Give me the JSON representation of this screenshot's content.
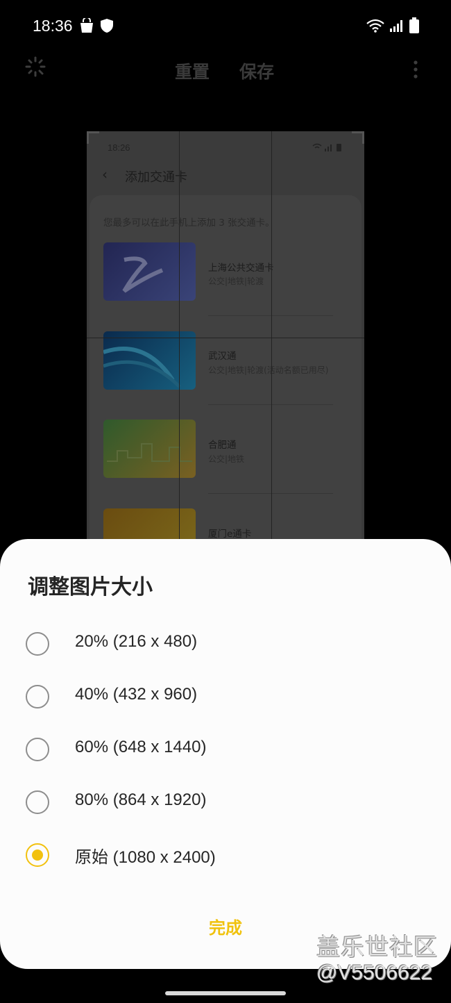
{
  "status_bar": {
    "time": "18:36",
    "icons": [
      "shopping-bag-icon",
      "shield-icon",
      "wifi-icon",
      "signal-icon",
      "battery-icon"
    ]
  },
  "toolbar": {
    "reset_label": "重置",
    "save_label": "保存",
    "icons": [
      "resize-icon",
      "more-options-icon"
    ]
  },
  "preview": {
    "time": "18:26",
    "title": "添加交通卡",
    "description": "您最多可以在此手机上添加 3 张交通卡。",
    "cards": [
      {
        "name": "上海公共交通卡",
        "subtitle": "公交|地铁|轮渡",
        "color_a": "#2a2c5a",
        "color_b": "#4a5aa0"
      },
      {
        "name": "武汉通",
        "subtitle": "公交|地铁|轮渡(活动名额已用尽)",
        "color_a": "#0d2f52",
        "color_b": "#1d6a8e"
      },
      {
        "name": "合肥通",
        "subtitle": "公交|地铁",
        "color_a": "#3b5a2a",
        "color_b": "#7a6a2a"
      },
      {
        "name": "厦门e通卡",
        "subtitle": "",
        "color_a": "#6a5214",
        "color_b": "#7a6a20"
      }
    ]
  },
  "sheet": {
    "title": "调整图片大小",
    "options": [
      {
        "label": "20% (216 x 480)",
        "checked": false
      },
      {
        "label": "40% (432 x 960)",
        "checked": false
      },
      {
        "label": "60% (648 x 1440)",
        "checked": false
      },
      {
        "label": "80% (864 x 1920)",
        "checked": false
      },
      {
        "label": "原始 (1080 x 2400)",
        "checked": true
      }
    ],
    "done_label": "完成"
  },
  "watermark": {
    "line1": "盖乐世社区",
    "line2": "@V5506622"
  },
  "colors": {
    "accent": "#f2c10e",
    "sheet_background": "#fcfcfc",
    "screen_background": "#000000"
  }
}
